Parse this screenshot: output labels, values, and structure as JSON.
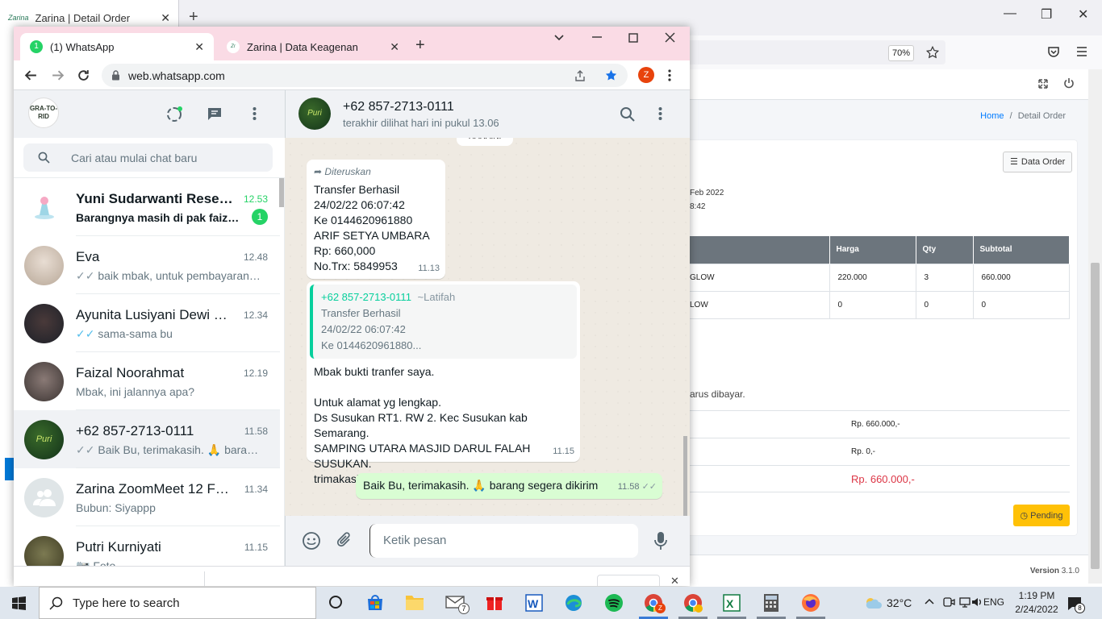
{
  "firefox": {
    "tab_title": "Zarina | Detail Order",
    "zoom": "70%"
  },
  "web": {
    "breadcrumb_home": "Home",
    "breadcrumb_sep": "/",
    "breadcrumb_current": "Detail Order",
    "data_order_btn": "Data Order",
    "order_date_partial": "Feb 2022",
    "order_time_partial": "8:42",
    "table_headers": [
      "Harga",
      "Qty",
      "Subtotal"
    ],
    "rows": [
      {
        "name": "GLOW",
        "harga": "220.000",
        "qty": "3",
        "subtotal": "660.000"
      },
      {
        "name": "LOW",
        "harga": "0",
        "qty": "0",
        "subtotal": "0"
      }
    ],
    "note_partial": "arus dibayar.",
    "sum_1": "Rp. 660.000,-",
    "sum_2": "Rp. 0,-",
    "sum_total": "Rp. 660.000,-",
    "status": "Pending",
    "version_label": "Version",
    "version_num": "3.1.0",
    "colors": {
      "link": "#007bff",
      "total": "#dc3545",
      "pending": "#ffc107"
    }
  },
  "chrome": {
    "tab1": "(1) WhatsApp",
    "tab1_badge": "1",
    "tab2": "Zarina | Data Keagenan",
    "url": "web.whatsapp.com",
    "avatar": "Z"
  },
  "whatsapp": {
    "logo_text": "GRA-TO-RID",
    "search_placeholder": "Cari atau mulai chat baru",
    "chats": [
      {
        "name": "Yuni Sudarwanti Resell...",
        "time": "12.53",
        "msg": "Barangnya masih di pak faizal s...",
        "unread": "1"
      },
      {
        "name": "Eva",
        "time": "12.48",
        "msg": "baik mbak, untuk pembayaran k..."
      },
      {
        "name": "Ayunita Lusiyani Dewi R...",
        "time": "12.34",
        "msg": "sama-sama bu"
      },
      {
        "name": "Faizal Noorahmat",
        "time": "12.19",
        "msg": "Mbak, ini jalannya apa?"
      },
      {
        "name": "+62 857-2713-0111",
        "time": "11.58",
        "msg": "Baik Bu, terimakasih. 🙏 barang..."
      },
      {
        "name": "Zarina ZoomMeet 12 Feb...",
        "time": "11.34",
        "msg": "Bubun: Siyappp"
      },
      {
        "name": "Putri Kurniyati",
        "time": "11.15",
        "msg": "Foto"
      }
    ],
    "contact_name": "+62 857-2713-0111",
    "contact_status": "terakhir dilihat hari ini pukul 13.06",
    "top_partial": "HARAINI",
    "forwarded_label": "Diteruskan",
    "msg1_lines": [
      "Transfer Berhasil",
      "24/02/22 06:07:42",
      "Ke 0144620961880",
      "ARIF SETYA UMBARA",
      "Rp: 660,000",
      "No.Trx: 5849953"
    ],
    "msg1_time": "11.13",
    "quote_author": "+62 857-2713-0111",
    "quote_alias": "~Latifah",
    "quote_lines": [
      "Transfer Berhasil",
      "24/02/22 06:07:42",
      "Ke 0144620961880..."
    ],
    "msg2_lines": [
      "Mbak bukti tranfer saya.",
      "",
      "Untuk alamat yg lengkap.",
      "Ds Susukan RT1. RW 2. Kec Susukan kab Semarang.",
      "SAMPING UTARA MASJID DARUL FALAH SUSUKAN.",
      "trimakasih. 🙏"
    ],
    "msg2_time": "11.15",
    "msg3": "Baik Bu, terimakasih. 🙏 barang segera dikirim",
    "msg3_time": "11.58",
    "compose_placeholder": "Ketik pesan",
    "green": "#25d366"
  },
  "taskbar": {
    "search_placeholder": "Type here to search",
    "mail_badge": "7",
    "chrome_badge": "Z",
    "weather": "32°C",
    "lang": "ENG",
    "time": "1:19 PM",
    "date": "2/24/2022",
    "notif_count": "8"
  }
}
